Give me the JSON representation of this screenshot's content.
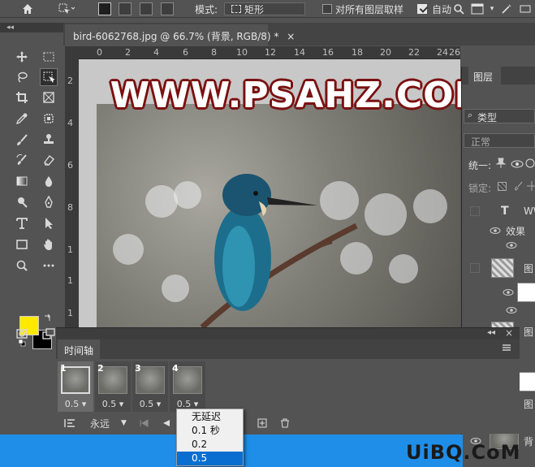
{
  "options_bar": {
    "mode_label": "模式:",
    "mode_value": "矩形",
    "sample_all_layers_label": "对所有图层取样",
    "auto_label": "自动",
    "tail_label": "▾"
  },
  "tabs": {
    "collapse_left": "◂◂",
    "document_title": "bird-6062768.jpg @ 66.7% (背景, RGB/8) *",
    "close": "×"
  },
  "ruler": {
    "top_ticks": [
      "0",
      "2",
      "4",
      "6",
      "8",
      "10",
      "12",
      "14",
      "16",
      "18",
      "20",
      "22",
      "24",
      "26"
    ],
    "left_ticks": [
      "2",
      "4",
      "6",
      "8",
      "1",
      "1",
      "1"
    ]
  },
  "canvas": {
    "watermark": "WWW.PSAHZ.COM"
  },
  "layers_panel": {
    "tab_label": "图层",
    "kind_label": "类型",
    "blend_mode": "正常",
    "unify_label": "统一:",
    "lock_label": "锁定:",
    "layer_text_name": "WW",
    "effects_label": "效果",
    "layer_label_1": "图",
    "layer_label_2": "图",
    "layer_label_3": "图",
    "layer_label_bg": "背"
  },
  "timeline": {
    "tab_label": "时间轴",
    "header_collapse": "◂◂",
    "header_close": "×",
    "frames": [
      {
        "number": "1",
        "delay": "0.5"
      },
      {
        "number": "2",
        "delay": "0.5"
      },
      {
        "number": "3",
        "delay": "0.5"
      },
      {
        "number": "4",
        "delay": "0.5"
      }
    ],
    "loop_value": "永远"
  },
  "delay_dropdown": {
    "options": [
      "无延迟",
      "0.1 秒",
      "0.2",
      "0.5"
    ],
    "selected": "0.5"
  },
  "footer": {
    "watermark": "UiBQ.CoM"
  },
  "colors": {
    "foreground": "#ffea00",
    "background": "#000000",
    "accent": "#0a6ed1",
    "watermark_outline": "#7a1010"
  }
}
